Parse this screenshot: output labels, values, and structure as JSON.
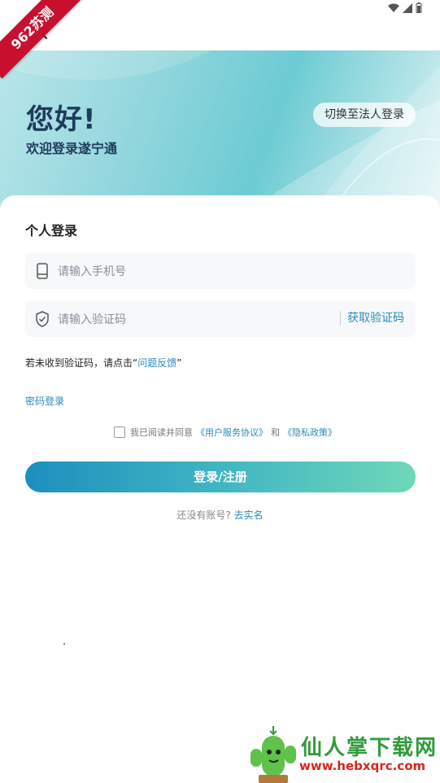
{
  "watermark": {
    "corner_text": "962苏测",
    "site_name": "仙人掌下载网",
    "site_url": "www.hebxqrc.com"
  },
  "header": {
    "close_icon": "close-icon",
    "hello": "您好!",
    "welcome": "欢迎登录遂宁通",
    "switch_label": "切换至法人登录"
  },
  "form": {
    "section_title": "个人登录",
    "phone": {
      "icon": "phone-icon",
      "placeholder": "请输入手机号",
      "value": ""
    },
    "code": {
      "icon": "shield-icon",
      "placeholder": "请输入验证码",
      "value": "",
      "get_code_label": "获取验证码"
    },
    "tip_prefix": "若未收到验证码，请点击“",
    "tip_link": "问题反馈",
    "tip_suffix": "”",
    "password_login": "密码登录",
    "agreement": {
      "prefix": "我已阅读并同意",
      "user_agreement": "《用户服务协议》",
      "and": "和",
      "privacy_policy": "《隐私政策》"
    },
    "login_button": "登录/注册",
    "no_account": "还没有账号?",
    "real_name_link": "去实名"
  },
  "colors": {
    "accent": "#2a8bb8",
    "title": "#1f3b5c"
  }
}
